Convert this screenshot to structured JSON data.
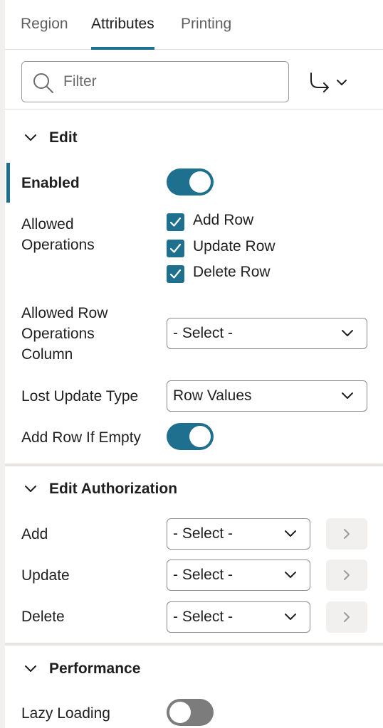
{
  "tabs": [
    {
      "label": "Region",
      "active": false
    },
    {
      "label": "Attributes",
      "active": true
    },
    {
      "label": "Printing",
      "active": false
    }
  ],
  "filter": {
    "placeholder": "Filter",
    "value": ""
  },
  "goto_icon": "goto-group-icon",
  "colors": {
    "accent": "#1f6f8e",
    "toggle_off": "#7c7c7c",
    "panel_bg": "#f1f0ee"
  },
  "edit": {
    "title": "Edit",
    "enabled": {
      "label": "Enabled",
      "on": true
    },
    "allowed_operations": {
      "label_line1": "Allowed",
      "label_line2": "Operations",
      "options": [
        {
          "label": "Add Row",
          "checked": true
        },
        {
          "label": "Update Row",
          "checked": true
        },
        {
          "label": "Delete Row",
          "checked": true
        }
      ]
    },
    "allowed_row_ops_column": {
      "label_line1": "Allowed Row",
      "label_line2": "Operations",
      "label_line3": "Column",
      "value": "- Select -"
    },
    "lost_update_type": {
      "label": "Lost Update Type",
      "value": "Row Values"
    },
    "add_row_if_empty": {
      "label": "Add Row If Empty",
      "on": true
    }
  },
  "edit_authorization": {
    "title": "Edit Authorization",
    "rows": [
      {
        "label": "Add",
        "value": "- Select -"
      },
      {
        "label": "Update",
        "value": "- Select -"
      },
      {
        "label": "Delete",
        "value": "- Select -"
      }
    ]
  },
  "performance": {
    "title": "Performance",
    "lazy_loading": {
      "label": "Lazy Loading",
      "on": false
    }
  }
}
